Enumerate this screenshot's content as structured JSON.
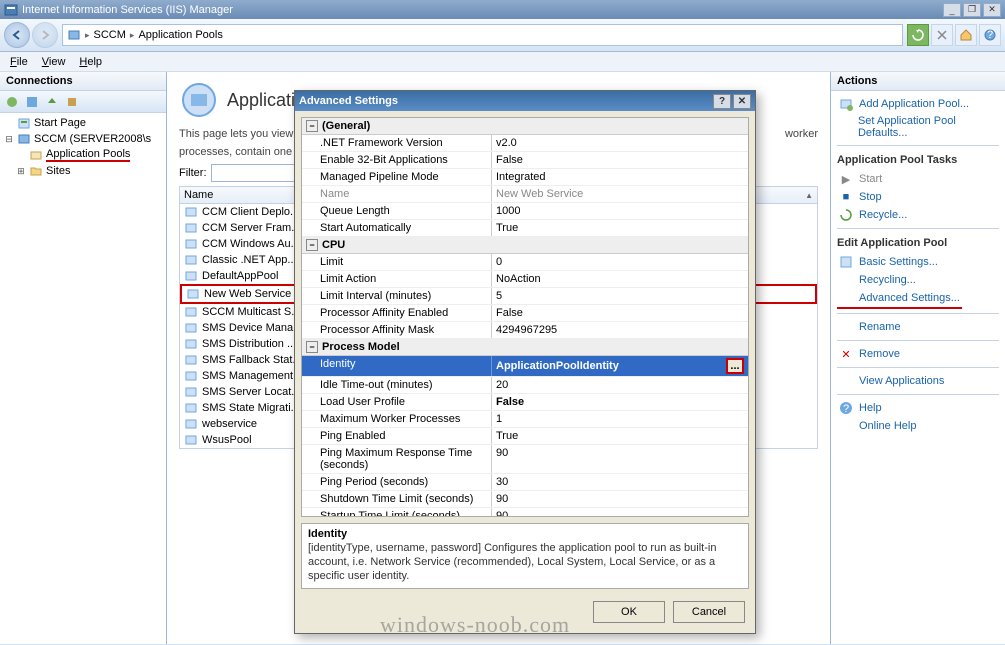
{
  "window_title": "Internet Information Services (IIS) Manager",
  "breadcrumb": [
    "SCCM",
    "Application Pools"
  ],
  "menu": {
    "file": "File",
    "view": "View",
    "help": "Help"
  },
  "connections": {
    "header": "Connections",
    "tree": {
      "start_page": "Start Page",
      "server": "SCCM (SERVER2008\\s",
      "app_pools": "Application Pools",
      "sites": "Sites"
    }
  },
  "center": {
    "title": "Applicati",
    "desc1": "This page lets you view",
    "desc2": "processes, contain one",
    "desc3_tail": "worker",
    "filter_label": "Filter:",
    "filter_value": "",
    "name_col": "Name",
    "items": [
      "CCM Client Deplo...",
      "CCM Server Fram...",
      "CCM Windows Au...",
      "Classic .NET App...",
      "DefaultAppPool",
      "New Web Service",
      "SCCM Multicast S...",
      "SMS Device Mana...",
      "SMS Distribution ...",
      "SMS Fallback Stat...",
      "SMS Management...",
      "SMS Server Locat...",
      "SMS State Migrati...",
      "webservice",
      "WsusPool"
    ]
  },
  "actions": {
    "header": "Actions",
    "add_pool": "Add Application Pool...",
    "set_defaults": "Set Application Pool Defaults...",
    "tasks_title": "Application Pool Tasks",
    "start": "Start",
    "stop": "Stop",
    "recycle": "Recycle...",
    "edit_title": "Edit Application Pool",
    "basic": "Basic Settings...",
    "recycling": "Recycling...",
    "advanced": "Advanced Settings...",
    "rename": "Rename",
    "remove": "Remove",
    "view_apps": "View Applications",
    "help": "Help",
    "online_help": "Online Help"
  },
  "modal": {
    "title": "Advanced Settings",
    "categories": {
      "general": "(General)",
      "cpu": "CPU",
      "process_model": "Process Model"
    },
    "props": {
      "net_framework": {
        "k": ".NET Framework Version",
        "v": "v2.0"
      },
      "enable_32": {
        "k": "Enable 32-Bit Applications",
        "v": "False"
      },
      "pipeline": {
        "k": "Managed Pipeline Mode",
        "v": "Integrated"
      },
      "name": {
        "k": "Name",
        "v": "New Web Service"
      },
      "queue_len": {
        "k": "Queue Length",
        "v": "1000"
      },
      "start_auto": {
        "k": "Start Automatically",
        "v": "True"
      },
      "limit": {
        "k": "Limit",
        "v": "0"
      },
      "limit_action": {
        "k": "Limit Action",
        "v": "NoAction"
      },
      "limit_interval": {
        "k": "Limit Interval (minutes)",
        "v": "5"
      },
      "affinity_enabled": {
        "k": "Processor Affinity Enabled",
        "v": "False"
      },
      "affinity_mask": {
        "k": "Processor Affinity Mask",
        "v": "4294967295"
      },
      "identity": {
        "k": "Identity",
        "v": "ApplicationPoolIdentity"
      },
      "idle_timeout": {
        "k": "Idle Time-out (minutes)",
        "v": "20"
      },
      "load_profile": {
        "k": "Load User Profile",
        "v": "False"
      },
      "max_workers": {
        "k": "Maximum Worker Processes",
        "v": "1"
      },
      "ping_enabled": {
        "k": "Ping Enabled",
        "v": "True"
      },
      "ping_max": {
        "k": "Ping Maximum Response Time (seconds)",
        "v": "90"
      },
      "ping_period": {
        "k": "Ping Period (seconds)",
        "v": "30"
      },
      "shutdown_limit": {
        "k": "Shutdown Time Limit (seconds)",
        "v": "90"
      },
      "startup_limit": {
        "k": "Startup Time Limit (seconds)",
        "v": "90"
      }
    },
    "desc": {
      "title": "Identity",
      "text": "[identityType, username, password] Configures the application pool to run as built-in account, i.e. Network Service (recommended), Local System, Local Service, or as a specific user identity."
    },
    "ok": "OK",
    "cancel": "Cancel"
  },
  "watermark": "windows-noob.com"
}
